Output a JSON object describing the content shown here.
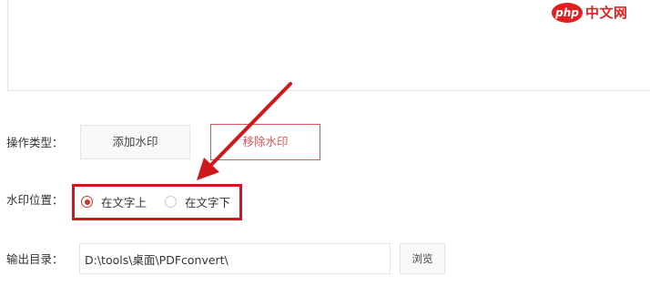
{
  "watermark": {
    "badge_text": "php",
    "site_text": "中文网",
    "color": "#e02020"
  },
  "operation": {
    "label": "操作类型：",
    "add_watermark_label": "添加水印",
    "remove_watermark_label": "移除水印",
    "selected": "remove"
  },
  "position": {
    "label": "水印位置：",
    "options": [
      {
        "label": "在文字上",
        "checked": true
      },
      {
        "label": "在文字下",
        "checked": false
      }
    ]
  },
  "output": {
    "label": "输出目录：",
    "path_value": "D:\\tools\\桌面\\PDFconvert\\",
    "browse_label": "浏览"
  },
  "annotation": {
    "color": "#d0171c",
    "icon": "red-arrow-pointing-down-left"
  },
  "accent_color": "#d85656"
}
